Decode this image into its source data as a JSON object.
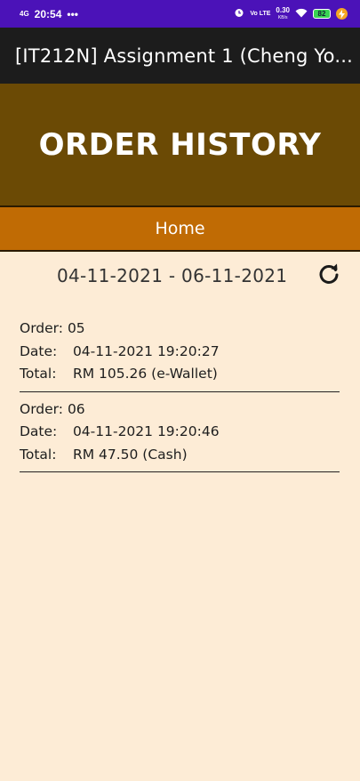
{
  "status_bar": {
    "network": "4G",
    "time": "20:54",
    "dots": "•••",
    "volte": "Vo LTE",
    "speed_value": "0.30",
    "speed_unit": "KB/s",
    "battery": "82"
  },
  "app_bar": {
    "title": "[IT212N] Assignment 1 (Cheng Yo..."
  },
  "banner": {
    "title": "ORDER HISTORY"
  },
  "nav": {
    "home_label": "Home"
  },
  "date_range": {
    "text": "04-11-2021 - 06-11-2021"
  },
  "orders": [
    {
      "order_label": "Order:",
      "order_value": "05",
      "date_label": "Date:",
      "date_value": "04-11-2021 19:20:27",
      "total_label": "Total:",
      "total_value": "RM 105.26 (e-Wallet)"
    },
    {
      "order_label": "Order:",
      "order_value": "06",
      "date_label": "Date:",
      "date_value": "04-11-2021 19:20:46",
      "total_label": "Total:",
      "total_value": "RM 47.50 (Cash)"
    }
  ],
  "colors": {
    "status_bar_bg": "#4b12b8",
    "app_bar_bg": "#1c1c1c",
    "banner_bg": "#6b4a05",
    "home_bar_bg": "#c06b04",
    "page_bg": "#fdecd6"
  },
  "icons": {
    "refresh": "refresh-icon",
    "alarm": "alarm-icon",
    "wifi": "wifi-icon",
    "battery": "battery-icon",
    "charging": "charging-icon"
  }
}
